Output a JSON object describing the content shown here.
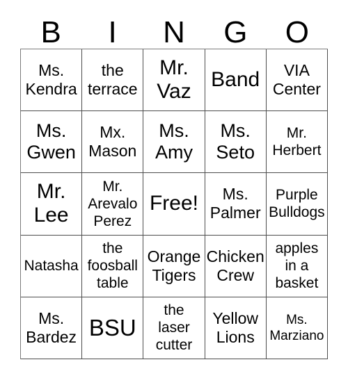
{
  "card": {
    "header_letters": [
      "B",
      "I",
      "N",
      "G",
      "O"
    ],
    "columns": 5,
    "rows": 5,
    "free_space_label": "Free!",
    "free_space_position": {
      "row": 3,
      "column": 3
    },
    "colors": {
      "background": "#ffffff",
      "text": "#000000",
      "grid_line": "#4d4d4d"
    },
    "cells": [
      [
        {
          "text": "Ms.\nKendra",
          "size": "md"
        },
        {
          "text": "the\nterrace",
          "size": "md"
        },
        {
          "text": "Mr.\nVaz",
          "size": "xl"
        },
        {
          "text": "Band",
          "size": "xl"
        },
        {
          "text": "VIA\nCenter",
          "size": "md"
        }
      ],
      [
        {
          "text": "Ms.\nGwen",
          "size": "lg"
        },
        {
          "text": "Mx.\nMason",
          "size": "md"
        },
        {
          "text": "Ms.\nAmy",
          "size": "lg"
        },
        {
          "text": "Ms.\nSeto",
          "size": "lg"
        },
        {
          "text": "Mr.\nHerbert",
          "size": "sm"
        }
      ],
      [
        {
          "text": "Mr.\nLee",
          "size": "xl"
        },
        {
          "text": "Mr.\nArevalo\nPerez",
          "size": "sm"
        },
        {
          "text": "Free!",
          "size": "xl"
        },
        {
          "text": "Ms.\nPalmer",
          "size": "md"
        },
        {
          "text": "Purple\nBulldogs",
          "size": "sm"
        }
      ],
      [
        {
          "text": "Natasha",
          "size": "sm"
        },
        {
          "text": "the\nfoosball\ntable",
          "size": "sm"
        },
        {
          "text": "Orange\nTigers",
          "size": "md"
        },
        {
          "text": "Chicken\nCrew",
          "size": "md"
        },
        {
          "text": "apples\nin a\nbasket",
          "size": "sm"
        }
      ],
      [
        {
          "text": "Ms.\nBardez",
          "size": "md"
        },
        {
          "text": "BSU",
          "size": "xxl"
        },
        {
          "text": "the\nlaser\ncutter",
          "size": "sm"
        },
        {
          "text": "Yellow\nLions",
          "size": "md"
        },
        {
          "text": "Ms.\nMarziano",
          "size": "xs"
        }
      ]
    ]
  }
}
